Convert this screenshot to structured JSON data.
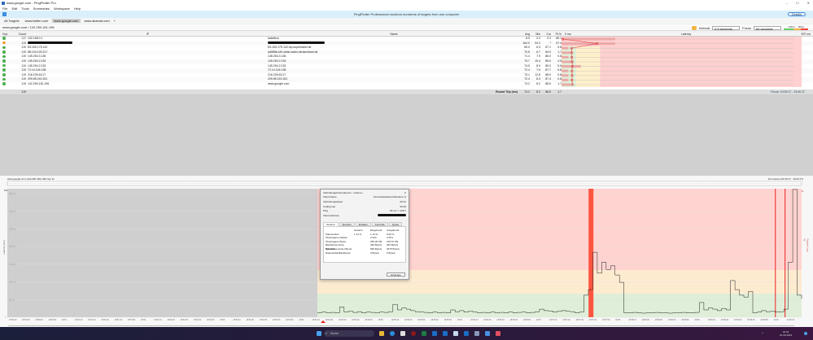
{
  "window": {
    "title": "www.google.com - PingPlotter Pro",
    "min": "–",
    "max": "☐",
    "close": "✕"
  },
  "menu": [
    "File",
    "Edit",
    "Tools",
    "Summaries",
    "Workspace",
    "Help"
  ],
  "banner": {
    "text": "PingPlotter Professional monitors hundreds of targets from one computer",
    "details": "Details"
  },
  "tabs": [
    {
      "label": "All Targets"
    },
    {
      "label": "www.twitter.com"
    },
    {
      "label": "www.google.com"
    },
    {
      "label": "www.akamai.com"
    }
  ],
  "add_tab": "+",
  "target": {
    "path": "www.google.com / 142.250.181.196"
  },
  "toolbar": {
    "interval_label": "Interval",
    "interval": "0.5 seconds",
    "focus_label": "Focus",
    "focus": "60 seconds",
    "legend_a": "100ms",
    "legend_b": "200ms"
  },
  "table": {
    "headers": {
      "hop": "Hop",
      "count": "Count",
      "ip": "IP",
      "name": "Name",
      "avg": "Avg",
      "min": "Min",
      "cur": "Cur",
      "pl": "PL%",
      "lat_min": "0 ms",
      "latency": "Latency",
      "lat_max": "997 ms"
    },
    "rows": [
      {
        "hop": "1",
        "count": "117",
        "ip": "192.168.0.1",
        "name": "kabelbox",
        "avg": "8.9",
        "min": "0.3",
        "cur": "0.3",
        "pl": "85.1",
        "status": "#4caf50",
        "redacted": false
      },
      {
        "hop": "2",
        "count": "113",
        "ip": "",
        "name": "",
        "avg": "164.0",
        "min": "94.2",
        "cur": "*",
        "pl": "97.4",
        "status": "#f0a030",
        "redacted": true
      },
      {
        "hop": "3",
        "count": "119",
        "ip": "83.169.175.142",
        "name": "83-169-175-142-isp.superkabel.de",
        "avg": "69.0",
        "min": "6.3",
        "cur": "67.1",
        "pl": "0.8",
        "status": "#4caf50",
        "redacted": false
      },
      {
        "hop": "4",
        "count": "119",
        "ip": "88.134.193.217",
        "name": "ip5886c1d9.static.kabel-deutschland.de",
        "avg": "70.6",
        "min": "6.7",
        "cur": "84.9",
        "pl": "1.7",
        "status": "#4caf50",
        "redacted": false
      },
      {
        "hop": "5",
        "count": "119",
        "ip": "145.254.3.136",
        "name": "145.254.3.136",
        "avg": "71.4",
        "min": "7.9",
        "cur": "86.0",
        "pl": "0.8",
        "status": "#4caf50",
        "redacted": false
      },
      {
        "hop": "6",
        "count": "119",
        "ip": "145.254.2.215",
        "name": "145.254.2.215",
        "avg": "73.7",
        "min": "10.4",
        "cur": "89.0",
        "pl": "2.5",
        "status": "#4caf50",
        "redacted": false
      },
      {
        "hop": "7",
        "count": "119",
        "ip": "145.254.2.215",
        "name": "145.254.2.215",
        "avg": "74.5",
        "min": "8.9",
        "cur": "89.0",
        "pl": "5.9",
        "status": "#4caf50",
        "redacted": false
      },
      {
        "hop": "8",
        "count": "119",
        "ip": "72.14.194.138",
        "name": "72.14.194.138",
        "avg": "72.4",
        "min": "7.9",
        "cur": "87.7",
        "pl": "0.8",
        "status": "#4caf50",
        "redacted": false
      },
      {
        "hop": "9",
        "count": "119",
        "ip": "216.239.63.17",
        "name": "216.239.63.17",
        "avg": "73.1",
        "min": "12.8",
        "cur": "88.9",
        "pl": "0.8",
        "status": "#4caf50",
        "redacted": false
      },
      {
        "hop": "10",
        "count": "119",
        "ip": "209.85.240.161",
        "name": "209.85.240.161",
        "avg": "72.4",
        "min": "8.3",
        "cur": "87.4",
        "pl": "0.8",
        "status": "#4caf50",
        "redacted": false
      },
      {
        "hop": "11",
        "count": "119",
        "ip": "142.250.181.196",
        "name": "www.google.com",
        "avg": "74.2",
        "min": "8.2",
        "cur": "88.5",
        "pl": "1.7",
        "status": "#4caf50",
        "redacted": false
      }
    ],
    "summary": {
      "count": "119",
      "label": "Round Trip (ms)",
      "avg": "74.2",
      "min": "8.2",
      "cur": "88.5",
      "pl": "1.7",
      "focus": "Focus: 19:39:17 - 19:40:17"
    }
  },
  "graph": {
    "title": "www.google.com (142.250.181.196) hop 11",
    "range": "10 minutes (19:30:17 - 19:40:17)",
    "y_label": "Latency (ms)",
    "pl_label": "Packet Loss %",
    "pl_top": "30",
    "y_ticks": [
      "350 ms",
      "300 ms",
      "250 ms",
      "200 ms",
      "150 ms",
      "100 ms",
      "50 ms",
      "0"
    ],
    "top_val": "100",
    "x_ticks": [
      "18:50:20",
      "18:50:30",
      "18:50:40",
      "18:50:50",
      "18:51",
      "18:51:10",
      "18:51:20",
      "18:51:30",
      "18:51:40",
      "18:51:50",
      "18:52",
      "18:52:10",
      "18:52:20",
      "18:52:30",
      "18:52:40",
      "18:52:50",
      "18:53",
      "18:53:10",
      "18:53:20",
      "18:53:30",
      "18:53:40",
      "18:53:50",
      "18:54",
      "18:54:10",
      "18:54:20",
      "18:54:30",
      "18:54:40",
      "18:54:50",
      "18:55",
      "18:55:10",
      "18:55:20",
      "18:55:30",
      "18:55:40",
      "18:55:50",
      "18:56",
      "18:56:10",
      "18:56:20",
      "18:56:30",
      "18:56:40",
      "18:56:50",
      "18:57",
      "18:57:10",
      "18:57:20",
      "18:57:30",
      "18:57:40",
      "18:57:50",
      "18:58",
      "18:58:10",
      "18:58:20",
      "18:58:30",
      "18:58:40",
      "18:58:50",
      "18:59",
      "18:59:10",
      "18:59:20",
      "18:59:30",
      "18:59:40",
      "18:59:50",
      "19:00",
      "19:00:10"
    ],
    "latency_ms": [
      12,
      14,
      12,
      13,
      12,
      28,
      14,
      16,
      13,
      15,
      12,
      14,
      13,
      12,
      14,
      13,
      15,
      35,
      20,
      25,
      22,
      18,
      15,
      14,
      13,
      12,
      14,
      12,
      13,
      12,
      20,
      15,
      18,
      14,
      16,
      14,
      12,
      13,
      12,
      14,
      12,
      13,
      12,
      14,
      12,
      13,
      14,
      12,
      13,
      15,
      22,
      18,
      17,
      14,
      16,
      18,
      16,
      15,
      12,
      14,
      60,
      75,
      177,
      120,
      150,
      130,
      140,
      115,
      95,
      12,
      12,
      13,
      12,
      11,
      12,
      12,
      13,
      12,
      12,
      11,
      12,
      12,
      13,
      12,
      12,
      13,
      40,
      20,
      25,
      22,
      18,
      24,
      20,
      100,
      75,
      60,
      55,
      70,
      12,
      14,
      18,
      15,
      16,
      14,
      15,
      22,
      150,
      348,
      60,
      50
    ],
    "loss_marks": [
      0.56,
      0.945,
      0.965
    ]
  },
  "dialog": {
    "title": "Verbindungsinformationen - Internet...",
    "fields": [
      {
        "k": "Client-Name",
        "v": "Internetbeitelbereichlecken-i-3"
      },
      {
        "k": "Verbindungsdauer",
        "v": "06:31"
      },
      {
        "k": "Untätig seit",
        "v": "06:26"
      },
      {
        "k": "Ping",
        "v": "83 ms ⇒ 125.7"
      },
      {
        "k": "Client-Adresse",
        "v": ""
      }
    ],
    "tabs": [
      "Gesamt",
      "Sprache",
      "Erhalten",
      "Kontrolle",
      "Quota"
    ],
    "cols": [
      "Gesamt",
      "Eingehend",
      "Ausgehend"
    ],
    "rows": [
      [
        "Paketverlust",
        "1.14 %",
        "1.14 %",
        "0.00 %"
      ],
      [
        "Übertragene Pakete",
        "",
        "2.224",
        "2.25 k"
      ],
      [
        "Übertragene Bytes",
        "",
        "265.20 KB",
        "136.57 KB"
      ],
      [
        "Bandbreite letzte Sekunde",
        "",
        "336 Byte/s",
        "253 Byte/s"
      ],
      [
        "Bandbreite letzte Minute",
        "",
        "690 Byte/s",
        "3075 Byte/s"
      ],
      [
        "Datenanfall Bandbreite",
        "",
        "0 Byte/s",
        "0 Byte/s"
      ]
    ],
    "close": "Schließen"
  },
  "taskbar": {
    "search": "Suche",
    "time": "19:40",
    "date": "22.06.2023"
  }
}
